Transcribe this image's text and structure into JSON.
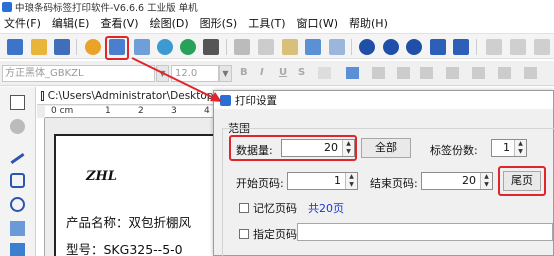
{
  "app": {
    "title": "中琅条码标签打印软件-V6.6.6 工业版 单机"
  },
  "menu": [
    "文件(F)",
    "编辑(E)",
    "查看(V)",
    "绘图(D)",
    "图形(S)",
    "工具(T)",
    "窗口(W)",
    "帮助(H)"
  ],
  "format": {
    "font": "方正黑体_GBKZL",
    "size": "12.0",
    "bold": "B",
    "italic": "I",
    "underline": "U",
    "strike": "S"
  },
  "document": {
    "path": "C:\\Users\\Administrator\\Desktop\\",
    "ruler": "0 cm",
    "ruler_numbers": [
      "1",
      "2",
      "3",
      "4"
    ],
    "logo": "ZHL",
    "product_line": "产品名称：双包折棚风",
    "model_line": "型号：SKG325--5-0"
  },
  "dialog": {
    "title": "打印设置",
    "group": "范围",
    "quantity_label": "数据量:",
    "quantity": "20",
    "all_button": "全部",
    "copies_label": "标签份数:",
    "copies": "1",
    "start_label": "开始页码:",
    "start": "1",
    "end_label": "结束页码:",
    "end": "20",
    "last_button": "尾页",
    "remember_label": "记忆页码",
    "total_pages": "共20页",
    "specify_label": "指定页码"
  },
  "colors": {
    "highlight": "#e0262b",
    "link": "#1a37d0",
    "accent": "#2a6fd6"
  }
}
